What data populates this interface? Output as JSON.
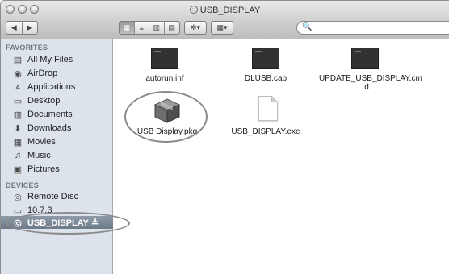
{
  "window": {
    "title": "USB_DISPLAY"
  },
  "toolbar": {
    "back_label": "◀",
    "forward_label": "▶",
    "view_icons": "▦",
    "view_list": "≡",
    "view_columns": "▥",
    "view_coverflow": "▤",
    "action_label": "✲▾",
    "arrange_label": "▦▾",
    "search_icon": "🔍"
  },
  "sidebar": {
    "favorites_header": "FAVORITES",
    "devices_header": "DEVICES",
    "favorites": [
      {
        "label": "All My Files",
        "icon": "all-files-icon",
        "glyph": "▤"
      },
      {
        "label": "AirDrop",
        "icon": "airdrop-icon",
        "glyph": "◉"
      },
      {
        "label": "Applications",
        "icon": "applications-icon",
        "glyph": "⩓"
      },
      {
        "label": "Desktop",
        "icon": "desktop-icon",
        "glyph": "▭"
      },
      {
        "label": "Documents",
        "icon": "documents-icon",
        "glyph": "▥"
      },
      {
        "label": "Downloads",
        "icon": "downloads-icon",
        "glyph": "⬇"
      },
      {
        "label": "Movies",
        "icon": "movies-icon",
        "glyph": "▦"
      },
      {
        "label": "Music",
        "icon": "music-icon",
        "glyph": "♫"
      },
      {
        "label": "Pictures",
        "icon": "pictures-icon",
        "glyph": "▣"
      }
    ],
    "devices": [
      {
        "label": "Remote Disc",
        "icon": "remote-disc-icon",
        "glyph": "◎"
      },
      {
        "label": "10.7.3",
        "icon": "hard-disk-icon",
        "glyph": "▭"
      },
      {
        "label": "USB_DISPLAY ≜",
        "icon": "usb-disk-icon",
        "glyph": "◎",
        "selected": true
      }
    ]
  },
  "files": [
    {
      "name": "autorun.inf"
    },
    {
      "name": "DLUSB.cab"
    },
    {
      "name": "UPDATE_USB_DISPLAY.cm\nd"
    },
    {
      "name": "USB Display.pkg"
    },
    {
      "name": "USB_DISPLAY.exe"
    }
  ],
  "colors": {
    "sidebar_bg": "#dde3ea",
    "selection": "#7c8896",
    "highlight_ring": "#8b8b8b"
  }
}
